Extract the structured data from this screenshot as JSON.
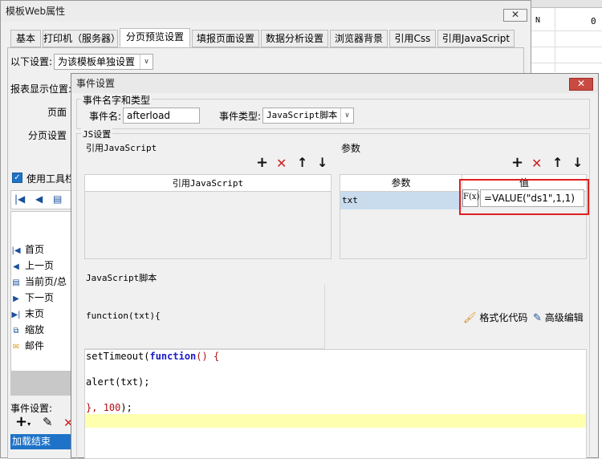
{
  "main_window": {
    "title": "模板Web属性",
    "close": "✕",
    "tabs": [
      "基本",
      "打印机（服务器）",
      "分页预览设置",
      "填报页面设置",
      "数据分析设置",
      "浏览器背景",
      "引用Css",
      "引用JavaScript"
    ],
    "setting_label": "以下设置:",
    "setting_value": "为该模板单独设置",
    "report_position_label": "报表显示位置:",
    "page_label": "页面",
    "paging_label": "分页设置",
    "use_toolbar_label": "使用工具栏",
    "toolbar_items": [
      "首页",
      "上一页",
      "当前页/总",
      "下一页",
      "末页",
      "缩放",
      "邮件"
    ],
    "event_setting_label": "事件设置:",
    "event_item": "加载结束"
  },
  "background_sheet": {
    "col_label": "N",
    "cell_value": "0"
  },
  "dialog": {
    "title": "事件设置",
    "close": "✕",
    "group_event": "事件名字和类型",
    "event_name_label": "事件名:",
    "event_name_value": "afterload",
    "event_type_label": "事件类型:",
    "event_type_value": "JavaScript脚本",
    "group_js": "JS设置",
    "ref_js_label": "引用JavaScript",
    "ref_js_col": "引用JavaScript",
    "params_label": "参数",
    "params_col_name": "参数",
    "params_col_value": "值",
    "param_name": "txt",
    "param_value": "=VALUE(\"ds1\",1,1)",
    "param_formula_icon": "F(x)",
    "script_label": "JavaScript脚本",
    "func_header": "function(txt){",
    "format_code": "格式化代码",
    "advanced_edit": "高级编辑",
    "code_lines": {
      "l1_kw1": "setTimeout(",
      "l1_kw2": "function",
      "l1_rest": "() {",
      "l2": "alert(txt);",
      "l3_a": "}, ",
      "l3_b": "100",
      "l3_c": ");"
    }
  },
  "toolbar_icons": {
    "add": "+",
    "delete": "✕",
    "up": "↑",
    "down": "↓"
  }
}
